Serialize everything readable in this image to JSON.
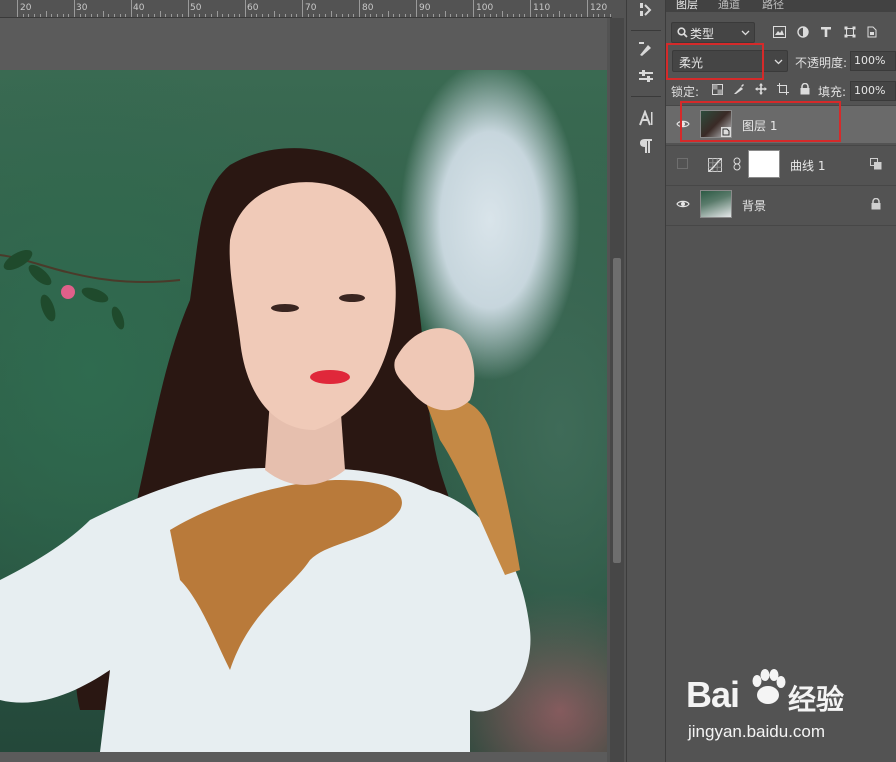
{
  "ruler": {
    "ticks": [
      "20",
      "30",
      "40",
      "50",
      "60",
      "70",
      "80",
      "90",
      "100",
      "110",
      "120"
    ]
  },
  "layers_panel": {
    "tabs": [
      "图层",
      "通道",
      "路径"
    ],
    "filter_kind": "类型",
    "blend_mode": "柔光",
    "opacity_label": "不透明度:",
    "opacity_value": "100%",
    "lock_label": "锁定:",
    "fill_label": "填充:",
    "fill_value": "100%",
    "layers": [
      {
        "name": "图层 1",
        "visible": true,
        "selected": true
      },
      {
        "name": "曲线 1",
        "visible": false,
        "selected": false
      },
      {
        "name": "背景",
        "visible": true,
        "selected": false,
        "locked": true
      }
    ]
  },
  "watermark": {
    "brand_bai": "Bai",
    "brand_du": "du",
    "brand_jingyan": "经验",
    "url": "jingyan.baidu.com"
  },
  "colors": {
    "ui_background": "#535353",
    "highlight_box": "#d52a2a",
    "selected_layer": "#6a6a6a"
  }
}
